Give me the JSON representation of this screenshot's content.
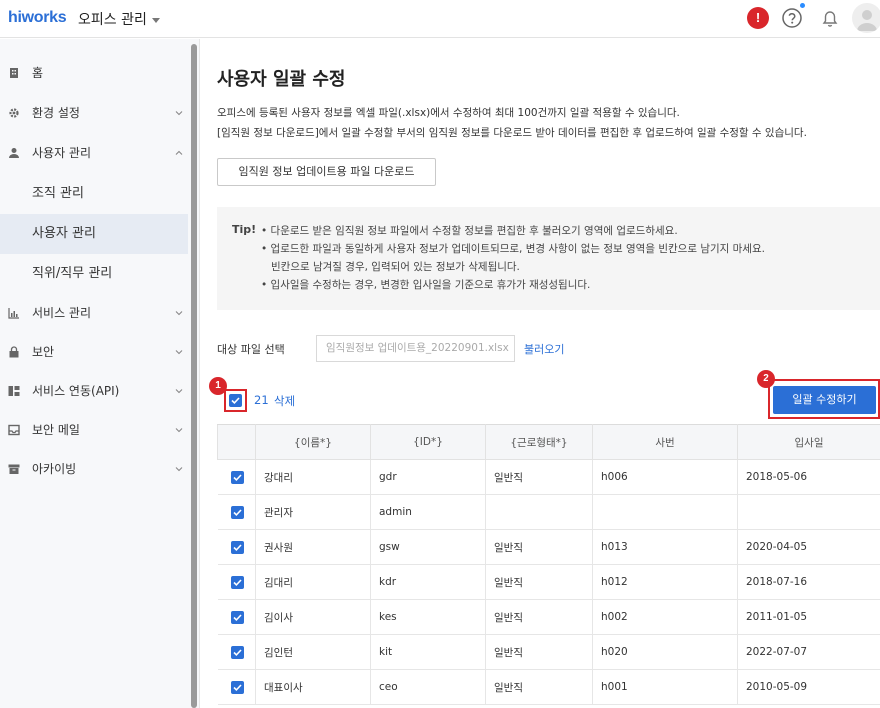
{
  "app": {
    "logo": "hiworks",
    "office_menu": "오피스 관리"
  },
  "topbar_icons": [
    "alert-icon",
    "help-icon",
    "bell-icon",
    "avatar"
  ],
  "sidebar": {
    "items": [
      {
        "label": "홈",
        "icon": "building-icon",
        "has_chevron": false
      },
      {
        "label": "환경 설정",
        "icon": "gear-icon",
        "has_chevron": true
      },
      {
        "label": "사용자 관리",
        "icon": "person-icon",
        "has_chevron": true,
        "expanded": true
      },
      {
        "label": "서비스 관리",
        "icon": "chart-icon",
        "has_chevron": true
      },
      {
        "label": "보안",
        "icon": "lock-icon",
        "has_chevron": true
      },
      {
        "label": "서비스 연동(API)",
        "icon": "api-icon",
        "has_chevron": true
      },
      {
        "label": "보안 메일",
        "icon": "mail-icon",
        "has_chevron": true
      },
      {
        "label": "아카이빙",
        "icon": "archive-icon",
        "has_chevron": true
      }
    ],
    "subitems": [
      {
        "label": "조직 관리",
        "active": false
      },
      {
        "label": "사용자 관리",
        "active": true
      },
      {
        "label": "직위/직무 관리",
        "active": false
      }
    ]
  },
  "main": {
    "title": "사용자 일괄 수정",
    "desc1": "오피스에 등록된 사용자 정보를 엑셀 파일(.xlsx)에서 수정하여 최대 100건까지 일괄 적용할 수 있습니다.",
    "desc2": "[임직원 정보 다운로드]에서 일괄 수정할 부서의 임직원 정보를 다운로드 받아 데이터를 편집한 후 업로드하여 일괄 수정할 수 있습니다.",
    "download_button": "임직원 정보 업데이트용 파일 다운로드",
    "tip_label": "Tip!",
    "tips": [
      "• 다운로드 받은 임직원 정보 파일에서 수정할 정보를 편집한 후 불러오기 영역에 업로드하세요.",
      "• 업로드한 파일과 동일하게 사용자 정보가 업데이트되므로, 변경 사항이 없는 정보 영역을 빈칸으로 남기지 마세요.",
      "빈칸으로 남겨질 경우, 입력되어 있는 정보가 삭제됩니다.",
      "• 입사일을 수정하는 경우, 변경한 입사일을 기준으로 휴가가 재성성됩니다."
    ],
    "file_label": "대상 파일 선택",
    "file_value": "임직원정보 업데이트용_20220901.xlsx",
    "load_link": "불러오기",
    "selected_count": "21",
    "delete_link": "삭제",
    "bulk_button": "일괄 수정하기",
    "badges": [
      "1",
      "2"
    ]
  },
  "table": {
    "headers": [
      "{이름*}",
      "{ID*}",
      "{근로형태*}",
      "사번",
      "입사일"
    ],
    "rows": [
      {
        "name": "강대리",
        "id": "gdr",
        "type": "일반직",
        "emp_no": "h006",
        "hire": "2018-05-06"
      },
      {
        "name": "관리자",
        "id": "admin",
        "type": "",
        "emp_no": "",
        "hire": ""
      },
      {
        "name": "권사원",
        "id": "gsw",
        "type": "일반직",
        "emp_no": "h013",
        "hire": "2020-04-05"
      },
      {
        "name": "김대리",
        "id": "kdr",
        "type": "일반직",
        "emp_no": "h012",
        "hire": "2018-07-16"
      },
      {
        "name": "김이사",
        "id": "kes",
        "type": "일반직",
        "emp_no": "h002",
        "hire": "2011-01-05"
      },
      {
        "name": "김인턴",
        "id": "kit",
        "type": "일반직",
        "emp_no": "h020",
        "hire": "2022-07-07"
      },
      {
        "name": "대표이사",
        "id": "ceo",
        "type": "일반직",
        "emp_no": "h001",
        "hire": "2010-05-09"
      }
    ]
  },
  "colors": {
    "accent": "#2b6fd6",
    "alert": "#d9262b",
    "sidebar_bg": "#f7f8fa"
  }
}
